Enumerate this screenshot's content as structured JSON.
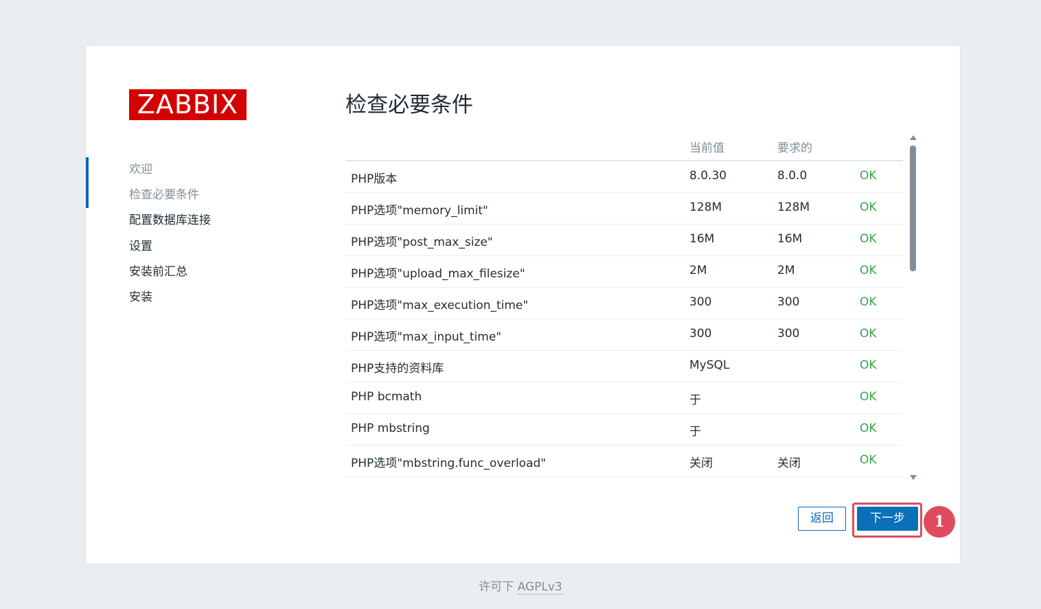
{
  "logo_text": "ZABBIX",
  "nav": {
    "items": [
      {
        "label": "欢迎",
        "state": "done"
      },
      {
        "label": "检查必要条件",
        "state": "done"
      },
      {
        "label": "配置数据库连接",
        "state": "todo"
      },
      {
        "label": "设置",
        "state": "todo"
      },
      {
        "label": "安装前汇总",
        "state": "todo"
      },
      {
        "label": "安装",
        "state": "todo"
      }
    ]
  },
  "page_title": "检查必要条件",
  "table": {
    "headers": {
      "current": "当前值",
      "required": "要求的"
    },
    "rows": [
      {
        "name": "PHP版本",
        "current": "8.0.30",
        "required": "8.0.0",
        "result": "OK"
      },
      {
        "name": "PHP选项\"memory_limit\"",
        "current": "128M",
        "required": "128M",
        "result": "OK"
      },
      {
        "name": "PHP选项\"post_max_size\"",
        "current": "16M",
        "required": "16M",
        "result": "OK"
      },
      {
        "name": "PHP选项\"upload_max_filesize\"",
        "current": "2M",
        "required": "2M",
        "result": "OK"
      },
      {
        "name": "PHP选项\"max_execution_time\"",
        "current": "300",
        "required": "300",
        "result": "OK"
      },
      {
        "name": "PHP选项\"max_input_time\"",
        "current": "300",
        "required": "300",
        "result": "OK"
      },
      {
        "name": "PHP支持的资料库",
        "current": "MySQL",
        "required": "",
        "result": "OK"
      },
      {
        "name": "PHP bcmath",
        "current": "于",
        "required": "",
        "result": "OK"
      },
      {
        "name": "PHP mbstring",
        "current": "于",
        "required": "",
        "result": "OK"
      },
      {
        "name": "PHP选项\"mbstring.func_overload\"",
        "current": "关闭",
        "required": "关闭",
        "result": "OK"
      }
    ]
  },
  "buttons": {
    "back": "返回",
    "next": "下一步"
  },
  "annotation_badge": "1",
  "footer": {
    "prefix": "许可下 ",
    "link": "AGPLv3"
  },
  "colors": {
    "brand_red": "#d40000",
    "accent_blue": "#0a70b8",
    "ok_green": "#3aa447",
    "highlight_red": "#e04b5e"
  }
}
